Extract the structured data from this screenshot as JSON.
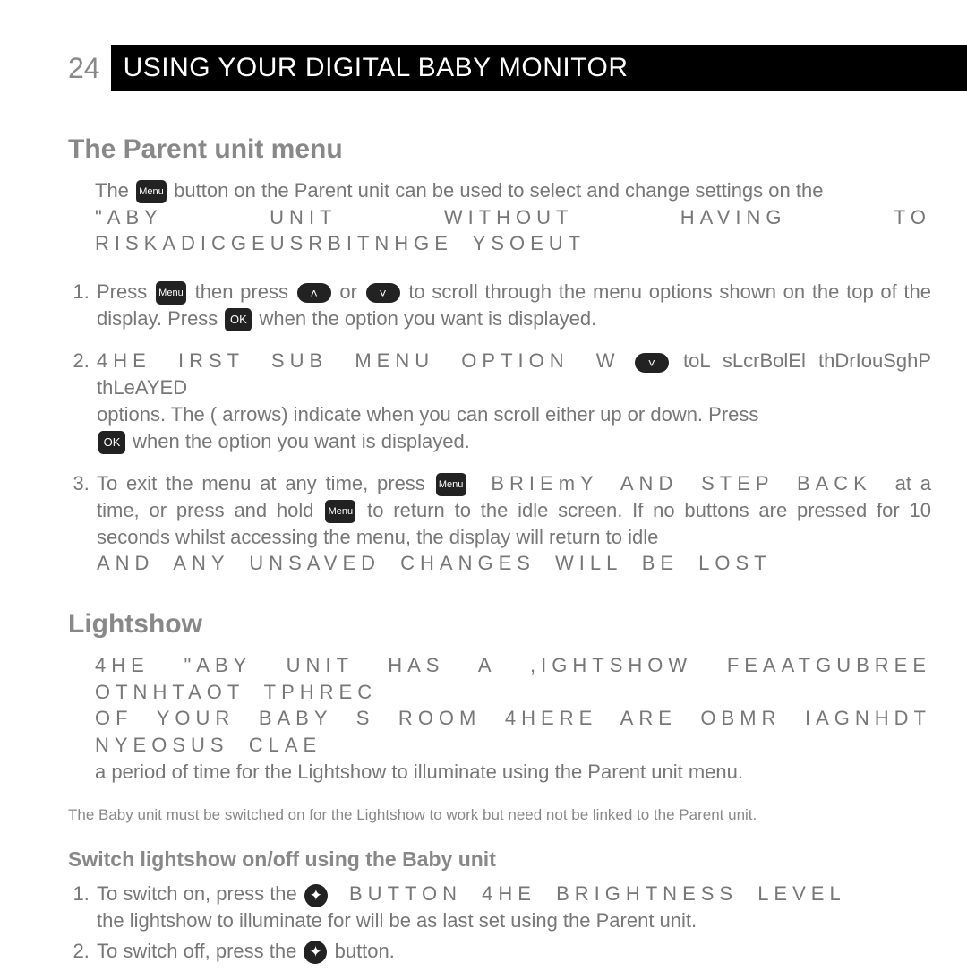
{
  "header": {
    "page_number": "24",
    "title": "USING YOUR DIGITAL BABY MONITOR"
  },
  "icons": {
    "menu_label": "Menu",
    "ok_label": "OK",
    "up_glyph": "˄",
    "down_glyph": "˅",
    "star_glyph": "✦"
  },
  "section1": {
    "heading": "The Parent unit menu",
    "intro_a": "The ",
    "intro_b": " button on the Parent unit can be used to select and change settings on the",
    "intro_c": "\"ABY UNIT WITHOUT HAVING TO RISKADICGEUSRBITNHGE YSOEUT",
    "step1_a": "Press ",
    "step1_b": " then press ",
    "step1_c": " or ",
    "step1_d": " to scroll through the menu options shown on the top of the display. Press ",
    "step1_e": " when the option you want is displayed.",
    "step2_a": "4HE IRST SUB MENU OPTION W",
    "step2_b": " toL sLcrBolEl thDrIouSghP thLeAYED",
    "step2_c": "options. The (    arrows) indicate when you can scroll either up or down. Press ",
    "step2_d": " when the option you want is displayed.",
    "step3_a": "To exit the menu at any time, press ",
    "step3_b": " BRIEmY AND STEP BACK ",
    "step3_c": "at a time, or press and hold ",
    "step3_d": " to return to the idle screen. If no buttons are pressed for 10 seconds whilst accessing the menu, the display will return to idle",
    "step3_e": "AND ANY UNSAVED CHANGES WILL BE LOST"
  },
  "section2": {
    "heading": "Lightshow",
    "p1": "4HE \"ABY UNIT HAS A ,IGHTSHOW FEAATGUBREE OTNHTAOT TPHREC",
    "p2": "OF YOUR BABY S ROOM 4HERE ARE  OBMR IAGNHDT NYEOSUS CLAE",
    "p3": "a period of time for the Lightshow to illuminate using the Parent unit menu.",
    "note": "The Baby unit must be switched on for the Lightshow to work but need not be linked to the Parent unit.",
    "subheading": "Switch lightshow on/off using the Baby unit",
    "s1_a": "To switch on, press the ",
    "s1_b": " BUTTON 4HE BRIGHTNESS LEVEL",
    "s1_c": "the lightshow to illuminate for will be as last set using the Parent unit.",
    "s2_a": "To switch off, press the ",
    "s2_b": " button."
  }
}
